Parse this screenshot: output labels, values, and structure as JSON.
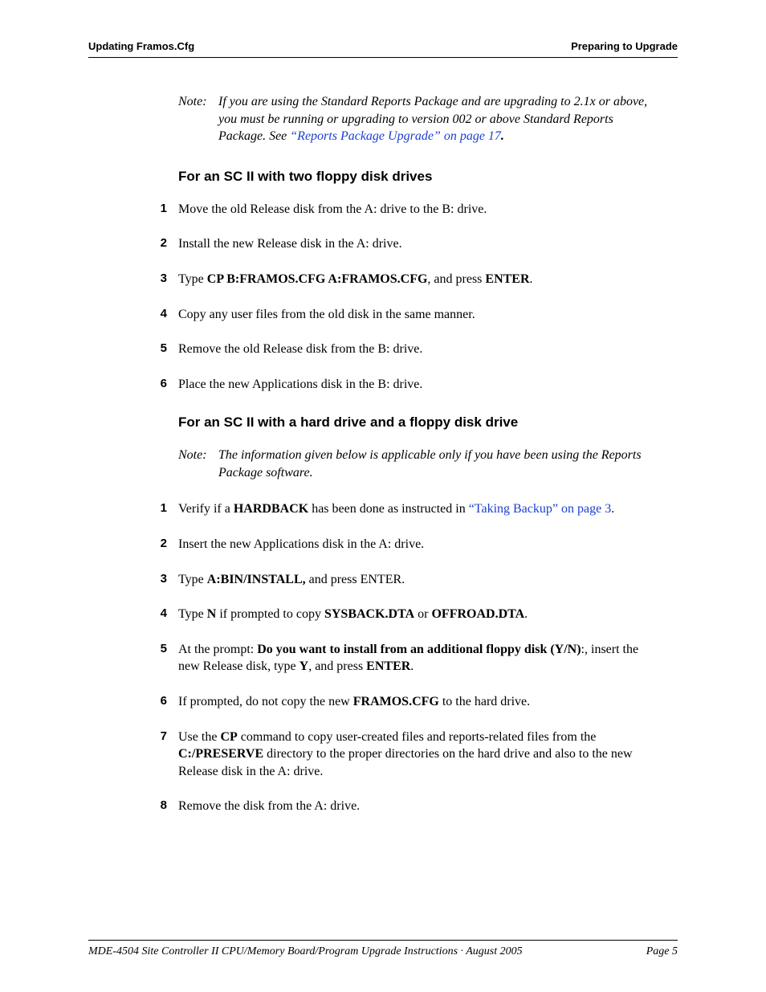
{
  "header": {
    "left": "Updating Framos.Cfg",
    "right": "Preparing to Upgrade"
  },
  "top_note": {
    "label": "Note:",
    "before_link": "If you are using the Standard Reports Package and are upgrading to 2.1x or above, you must be running or upgrading to version 002 or above Standard Reports Package. See ",
    "link": "“Reports Package Upgrade” on page 17",
    "after_link": "."
  },
  "section_a": {
    "title": "For an SC II with two floppy disk drives",
    "steps": [
      {
        "n": "1",
        "html": "Move the old Release disk from the A: drive to the B: drive."
      },
      {
        "n": "2",
        "html": "Install the new Release disk in the A: drive."
      },
      {
        "n": "3",
        "html": "Type <span class='b'>CP B:FRAMOS.CFG A:FRAMOS.CFG</span>, and press <span class='b'>ENTER</span>."
      },
      {
        "n": "4",
        "html": "Copy any user files from the old disk in the same manner."
      },
      {
        "n": "5",
        "html": "Remove the old Release disk from the B: drive."
      },
      {
        "n": "6",
        "html": "Place the new Applications disk in the B: drive."
      }
    ]
  },
  "section_b": {
    "title": "For an SC II with a hard drive and a floppy disk drive",
    "note": {
      "label": "Note:",
      "text": "The information given below is applicable only if you have been using the Reports Package software."
    },
    "steps": [
      {
        "n": "1",
        "html": "Verify if a <span class='b'>HARDBACK</span> has been done as instructed in <span class='link' style='font-style:normal'>“Taking Backup” on page 3</span>."
      },
      {
        "n": "2",
        "html": "Insert the new Applications disk in the A: drive."
      },
      {
        "n": "3",
        "html": "Type <span class='b'>A:BIN/INSTALL,</span> and press ENTER."
      },
      {
        "n": "4",
        "html": "Type <span class='b'>N</span> if prompted to copy <span class='b'>SYSBACK.DTA</span> or <span class='b'>OFFROAD.DTA</span>."
      },
      {
        "n": "5",
        "html": "At the prompt: <span class='b'>Do you want to install from an additional floppy disk (Y/N)</span>:, insert the new Release disk, type <span class='b'>Y</span>, and press <span class='b'>ENTER</span>."
      },
      {
        "n": "6",
        "html": "If prompted, do not copy the new <span class='b'>FRAMOS.CFG</span> to the hard drive."
      },
      {
        "n": "7",
        "html": "Use the <span class='b'>CP</span> command to copy user-created files and reports-related files from the <span class='b'>C:/PRESERVE</span> directory to the proper directories on the hard drive and also to the new Release disk in the A: drive."
      },
      {
        "n": "8",
        "html": "Remove the disk from the A: drive."
      }
    ]
  },
  "footer": {
    "left": "MDE-4504 Site Controller II CPU/Memory Board/Program Upgrade Instructions · August 2005",
    "right": "Page 5"
  }
}
